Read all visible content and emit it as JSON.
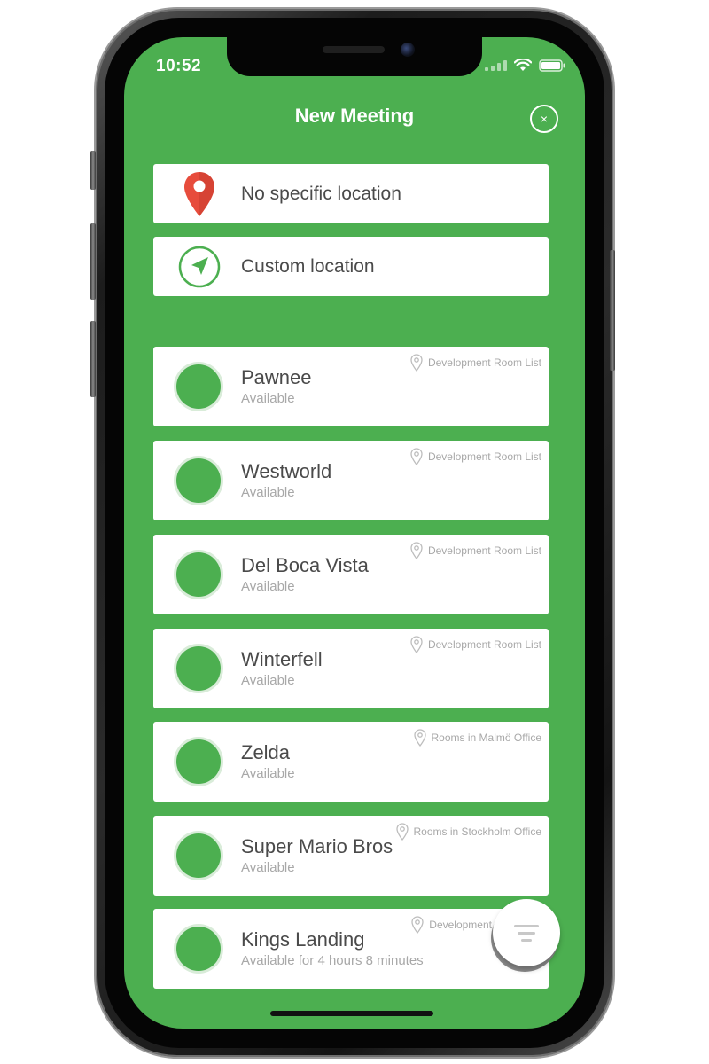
{
  "status_bar": {
    "time": "10:52",
    "wifi_icon": "wifi-icon",
    "battery_icon": "battery-icon"
  },
  "header": {
    "title": "New Meeting",
    "close_label": "×"
  },
  "location_options": [
    {
      "label": "No specific location",
      "icon": "map-pin-icon",
      "icon_color": "#e74c3c"
    },
    {
      "label": "Custom location",
      "icon": "navigation-arrow-icon",
      "icon_color": "#4caf50"
    }
  ],
  "rooms": [
    {
      "name": "Pawnee",
      "status": "Available",
      "list": "Development Room List"
    },
    {
      "name": "Westworld",
      "status": "Available",
      "list": "Development Room List"
    },
    {
      "name": "Del Boca Vista",
      "status": "Available",
      "list": "Development Room List"
    },
    {
      "name": "Winterfell",
      "status": "Available",
      "list": "Development Room List"
    },
    {
      "name": "Zelda",
      "status": "Available",
      "list": "Rooms in Malmö Office"
    },
    {
      "name": "Super Mario Bros",
      "status": "Available",
      "list": "Rooms in Stockholm Office"
    },
    {
      "name": "Kings Landing",
      "status": "Available for 4 hours 8 minutes",
      "list": "Development"
    }
  ],
  "filter_button_icon": "filter-icon",
  "colors": {
    "background_green": "#4caf50",
    "available_dot": "#4caf50",
    "pin_red": "#e74c3c",
    "text_dark": "#4a4a4a",
    "text_muted": "#a8a8a8"
  }
}
